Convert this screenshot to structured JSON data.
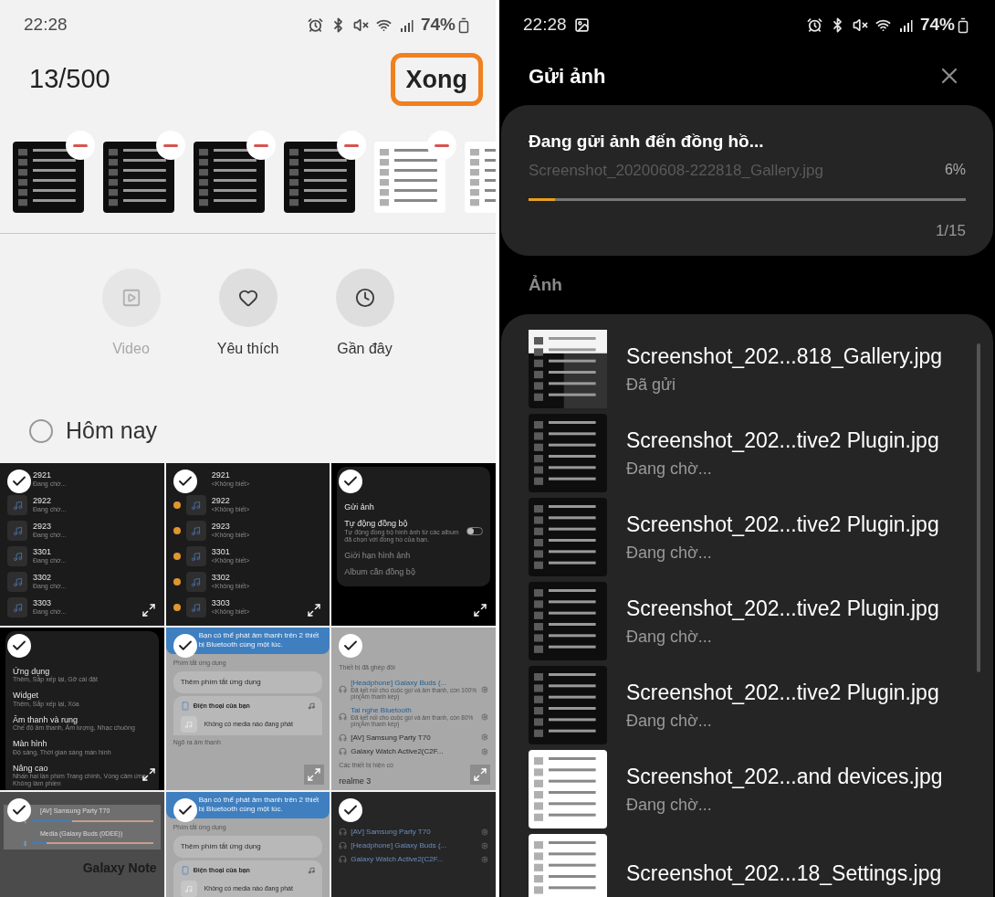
{
  "left": {
    "status_bar": {
      "time": "22:28",
      "battery": "74%"
    },
    "selection_count": "13/500",
    "done_button": "Xong",
    "selected_strip": [
      {
        "kind": "dark",
        "remove_button": true
      },
      {
        "kind": "dark",
        "remove_button": true
      },
      {
        "kind": "dark",
        "remove_button": true
      },
      {
        "kind": "dark",
        "remove_button": true
      },
      {
        "kind": "light",
        "remove_button": true
      },
      {
        "kind": "light"
      }
    ],
    "shortcuts": [
      {
        "label": "Video",
        "kind": "video",
        "disabled": true
      },
      {
        "label": "Yêu thích",
        "kind": "heart",
        "disabled": false
      },
      {
        "label": "Gần đây",
        "kind": "clock",
        "disabled": false
      }
    ],
    "section": {
      "label": "Hôm nay",
      "checked": false
    },
    "grid": [
      {
        "kind": "dark",
        "selected": true,
        "expand_button": true,
        "items": [
          {
            "kind": "music",
            "title": "2921",
            "sub": "Đang chờ..."
          },
          {
            "kind": "music",
            "title": "2922",
            "sub": "Đang chờ..."
          },
          {
            "kind": "music",
            "title": "2923",
            "sub": "Đang chờ..."
          },
          {
            "kind": "music",
            "title": "3301",
            "sub": "Đang chờ..."
          },
          {
            "kind": "music",
            "title": "3302",
            "sub": "Đang chờ..."
          },
          {
            "kind": "music",
            "title": "3303",
            "sub": "Đang chờ..."
          }
        ]
      },
      {
        "kind": "dark",
        "selected": true,
        "expand_button": true,
        "items": [
          {
            "kind": "music",
            "title": "2921",
            "sub": "<Không biết>",
            "marked": false
          },
          {
            "kind": "music",
            "title": "2922",
            "sub": "<Không biết>",
            "marked": true
          },
          {
            "kind": "music",
            "title": "2923",
            "sub": "<Không biết>",
            "marked": true
          },
          {
            "kind": "music",
            "title": "3301",
            "sub": "<Không biết>",
            "marked": true
          },
          {
            "kind": "music",
            "title": "3302",
            "sub": "<Không biết>",
            "marked": true
          },
          {
            "kind": "music",
            "title": "3303",
            "sub": "<Không biết>",
            "marked": true
          }
        ]
      },
      {
        "kind": "black",
        "selected": true,
        "expand_button": true,
        "items": [
          {
            "kind": "row",
            "title": "Gửi ảnh"
          },
          {
            "kind": "row",
            "title": "Tự động đồng bộ",
            "sub": "Tự động đồng bộ hình ảnh từ các album đã chọn với đồng hồ của bạn.",
            "on": false
          },
          {
            "kind": "row",
            "title": "Giới hạn hình ảnh",
            "disabled": true
          },
          {
            "kind": "row",
            "title": "Album cần đồng bộ",
            "disabled": true
          }
        ]
      },
      {
        "kind": "black",
        "selected": true,
        "expand_button": true,
        "items": [
          {
            "kind": "row",
            "title": "Ứng dụng",
            "sub": "Thêm, Sắp xếp lại, Gỡ cài đặt"
          },
          {
            "kind": "row",
            "title": "Widget",
            "sub": "Thêm, Sắp xếp lại, Xóa"
          },
          {
            "kind": "row",
            "title": "Âm thanh và rung",
            "sub": "Chế độ âm thanh, Âm lượng, Nhạc chuông"
          },
          {
            "kind": "row",
            "title": "Màn hình",
            "sub": "Độ sáng, Thời gian sáng màn hình"
          },
          {
            "kind": "row",
            "title": "Nâng cao",
            "sub": "Nhấn hai lần phím Trang chính, Vòng cảm ứng, Không làm phiền"
          }
        ]
      },
      {
        "kind": "gray",
        "selected": true,
        "expand_button": true,
        "items": [
          {
            "kind": "banner",
            "title": "Bạn có thể phát âm thanh trên 2 thiết bị Bluetooth cùng một lúc."
          },
          {
            "kind": "header",
            "title": "Phím tắt ứng dụng"
          },
          {
            "kind": "card",
            "title": "Thêm phím tắt ứng dụng"
          },
          {
            "kind": "player",
            "title": "Điện thoại của bạn"
          },
          {
            "kind": "media",
            "title": "Không có media nào đang phát"
          },
          {
            "kind": "header",
            "title": "Ngõ ra âm thanh"
          }
        ]
      },
      {
        "kind": "gray",
        "selected": true,
        "expand_button": true,
        "items": [
          {
            "kind": "header",
            "title": "Thiết bị đã ghép đôi"
          },
          {
            "kind": "device",
            "title": "[Headphone] Galaxy Buds (...",
            "sub": "Đã kết nối cho cuộc gọi và âm thanh, còn 100% pin(Âm thanh kép)",
            "connected": true
          },
          {
            "kind": "device",
            "title": "Tai nghe Bluetooth",
            "sub": "Đã kết nối cho cuộc gọi và âm thanh, còn 80% pin(Âm thanh kép)",
            "connected": true
          },
          {
            "kind": "device",
            "title": "[AV] Samsung Party T70",
            "connected": false
          },
          {
            "kind": "device",
            "title": "Galaxy Watch Active2(C2F...",
            "connected": false
          },
          {
            "kind": "header",
            "title": "Các thiết bị hiện có"
          },
          {
            "kind": "row",
            "title": "realme 3"
          }
        ]
      },
      {
        "kind": "video",
        "selected": true,
        "items": [
          {
            "kind": "slider",
            "title": "[AV] Samsung Party T70",
            "level": 0.33
          },
          {
            "kind": "slider",
            "title": "Media (Galaxy Buds (0DEE))",
            "level": 0.12
          },
          {
            "kind": "overlay",
            "title": "Galaxy Note"
          }
        ]
      },
      {
        "kind": "gray",
        "selected": true,
        "items": [
          {
            "kind": "banner",
            "title": "Bạn có thể phát âm thanh trên 2 thiết bị Bluetooth cùng một lúc."
          },
          {
            "kind": "header",
            "title": "Phím tắt ứng dụng"
          },
          {
            "kind": "card",
            "title": "Thêm phím tắt ứng dụng"
          },
          {
            "kind": "player",
            "title": "Điện thoại của bạn"
          },
          {
            "kind": "media",
            "title": "Không có media nào đang phát"
          }
        ]
      },
      {
        "kind": "dim",
        "selected": true,
        "items": [
          {
            "kind": "device",
            "title": "[AV] Samsung Party T70",
            "connected": true
          },
          {
            "kind": "device",
            "title": "[Headphone] Galaxy Buds (...",
            "connected": true
          },
          {
            "kind": "device",
            "title": "Galaxy Watch Active2(C2F...",
            "connected": true
          }
        ]
      }
    ]
  },
  "right": {
    "status_bar": {
      "time": "22:28",
      "battery": "74%"
    },
    "title": "Gửi ảnh",
    "progress": {
      "title": "Đang gửi ảnh đến đồng hồ...",
      "file": "Screenshot_20200608-222818_Gallery.jpg",
      "percent": "6%",
      "level": 0.06,
      "count": "1/15"
    },
    "section_label": "Ảnh",
    "files": [
      {
        "name": "Screenshot_202...818_Gallery.jpg",
        "status": "Đã gửi",
        "kind": "mixed"
      },
      {
        "name": "Screenshot_202...tive2 Plugin.jpg",
        "status": "Đang chờ...",
        "kind": "dark"
      },
      {
        "name": "Screenshot_202...tive2 Plugin.jpg",
        "status": "Đang chờ...",
        "kind": "dark"
      },
      {
        "name": "Screenshot_202...tive2 Plugin.jpg",
        "status": "Đang chờ...",
        "kind": "dark"
      },
      {
        "name": "Screenshot_202...tive2 Plugin.jpg",
        "status": "Đang chờ...",
        "kind": "dark"
      },
      {
        "name": "Screenshot_202...and devices.jpg",
        "status": "Đang chờ...",
        "kind": "light"
      },
      {
        "name": "Screenshot_202...18_Settings.jpg",
        "kind": "light"
      }
    ]
  }
}
